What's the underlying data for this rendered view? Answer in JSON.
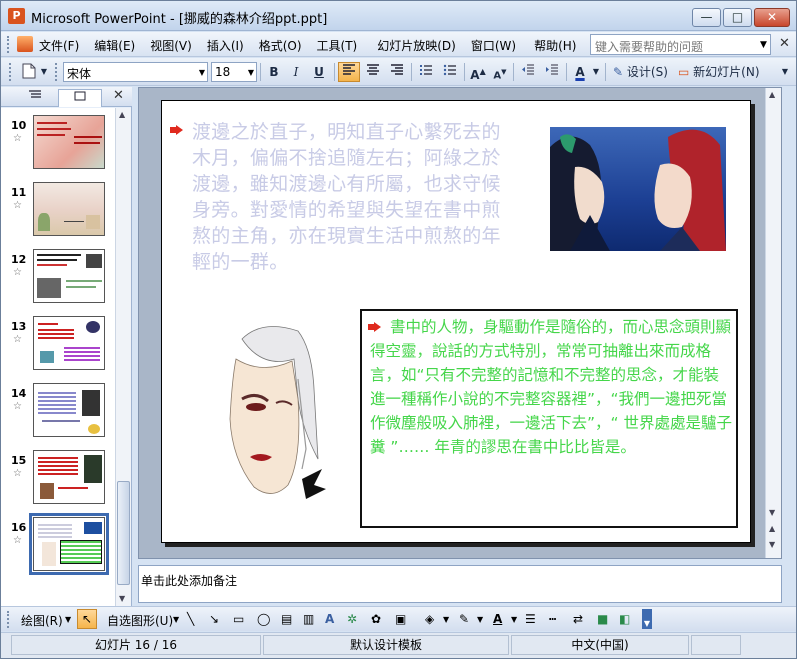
{
  "window": {
    "title": "Microsoft PowerPoint - [挪威的森林介绍ppt.ppt]",
    "min": "—",
    "max": "□",
    "close": "✕"
  },
  "menu": {
    "items": [
      "文件(F)",
      "编辑(E)",
      "视图(V)",
      "插入(I)",
      "格式(O)",
      "工具(T)",
      "幻灯片放映(D)",
      "窗口(W)",
      "帮助(H)"
    ],
    "help_placeholder": "键入需要帮助的问题"
  },
  "toolbar": {
    "font": "宋体",
    "size": "18",
    "bold": "B",
    "italic": "I",
    "underline": "U",
    "grow": "A",
    "shrink": "A",
    "color": "A",
    "design": "设计(S)",
    "new_slide": "新幻灯片(N)"
  },
  "left_panel": {
    "close": "✕",
    "thumbnails": [
      {
        "num": "10"
      },
      {
        "num": "11"
      },
      {
        "num": "12"
      },
      {
        "num": "13"
      },
      {
        "num": "14"
      },
      {
        "num": "15"
      },
      {
        "num": "16"
      }
    ]
  },
  "slide": {
    "paragraph1": "渡邊之於直子，明知直子心繫死去的木月，偏偏不捨追隨左右；阿綠之於渡邊，雖知渡邊心有所屬，也求守候身旁。對愛情的希望與失望在書中煎熬的主角，亦在現實生活中煎熬的年輕的一群。",
    "paragraph2": "書中的人物，身驅動作是隨俗的，而心思念頭則顯得空靈，說話的方式特別，常常可抽離出來而成格言，如“只有不完整的記憶和不完整的思念，才能裝進一種稱作小說的不完整容器裡”，“我們一邊把死當作微塵般吸入肺裡，一邊活下去”，“ 世界處處是驢子糞 ”…… 年青的謬思在書中比比皆是。"
  },
  "notes": {
    "placeholder": "单击此处添加备注"
  },
  "drawbar": {
    "draw": "绘图(R)",
    "autoshapes": "自选图形(U)"
  },
  "status": {
    "slide": "幻灯片 16 / 16",
    "template": "默认设计模板",
    "language": "中文(中国)"
  }
}
